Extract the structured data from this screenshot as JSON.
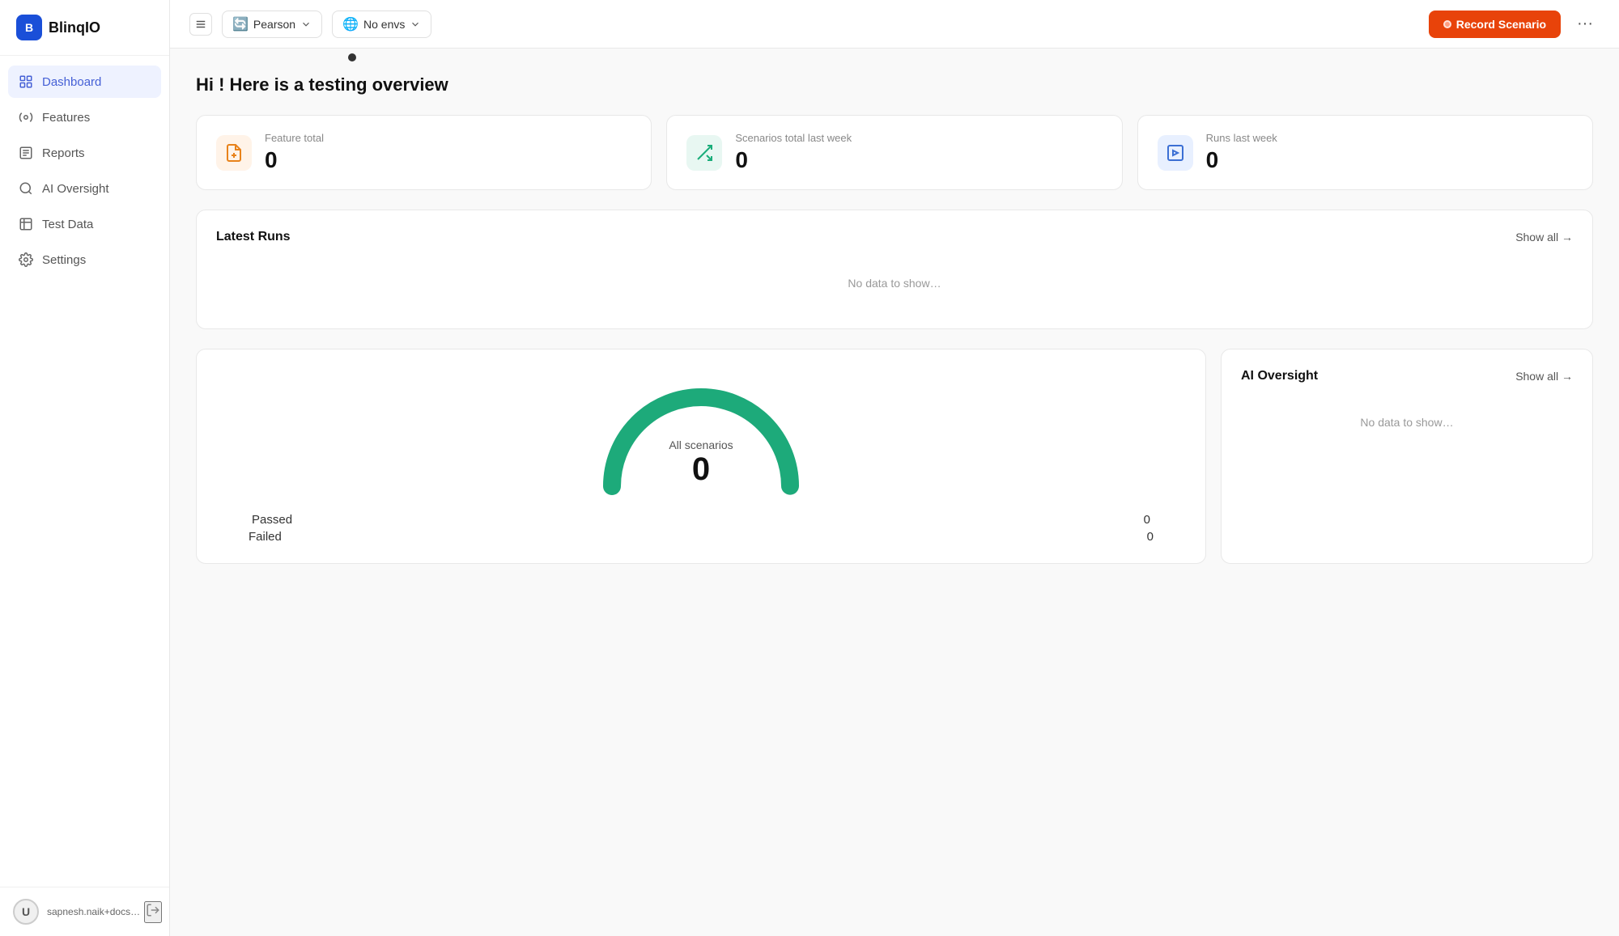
{
  "app": {
    "name": "BlinqIO",
    "logo_letter": "B"
  },
  "sidebar": {
    "nav_items": [
      {
        "id": "dashboard",
        "label": "Dashboard",
        "icon": "🏠",
        "active": true
      },
      {
        "id": "features",
        "label": "Features",
        "icon": "⚙️",
        "active": false
      },
      {
        "id": "reports",
        "label": "Reports",
        "icon": "📋",
        "active": false
      },
      {
        "id": "ai-oversight",
        "label": "AI Oversight",
        "icon": "🔍",
        "active": false
      },
      {
        "id": "test-data",
        "label": "Test Data",
        "icon": "🔬",
        "active": false
      },
      {
        "id": "settings",
        "label": "Settings",
        "icon": "⚙️",
        "active": false
      }
    ],
    "user": {
      "email": "sapnesh.naik+docs@...",
      "avatar_letter": "U"
    }
  },
  "topbar": {
    "org_name": "Pearson",
    "env_name": "No envs",
    "record_button_label": "Record Scenario"
  },
  "content": {
    "greeting": "Hi ! Here is a testing overview",
    "stat_cards": [
      {
        "id": "feature-total",
        "label": "Feature total",
        "value": "0",
        "icon": "📄",
        "icon_class": "stat-icon-feature"
      },
      {
        "id": "scenarios-total",
        "label": "Scenarios total last week",
        "value": "0",
        "icon": "🔀",
        "icon_class": "stat-icon-scenarios"
      },
      {
        "id": "runs-last-week",
        "label": "Runs last week",
        "value": "0",
        "icon": "💻",
        "icon_class": "stat-icon-runs"
      }
    ],
    "latest_runs": {
      "title": "Latest Runs",
      "show_all": "Show all →",
      "empty_message": "No data to show…"
    },
    "gauge": {
      "label": "All scenarios",
      "value": "0",
      "passed_label": "Passed",
      "passed_value": "0",
      "failed_label": "Failed",
      "failed_value": "0"
    },
    "ai_oversight": {
      "title": "AI Oversight",
      "show_all": "Show all →",
      "empty_message": "No data to show…"
    }
  }
}
